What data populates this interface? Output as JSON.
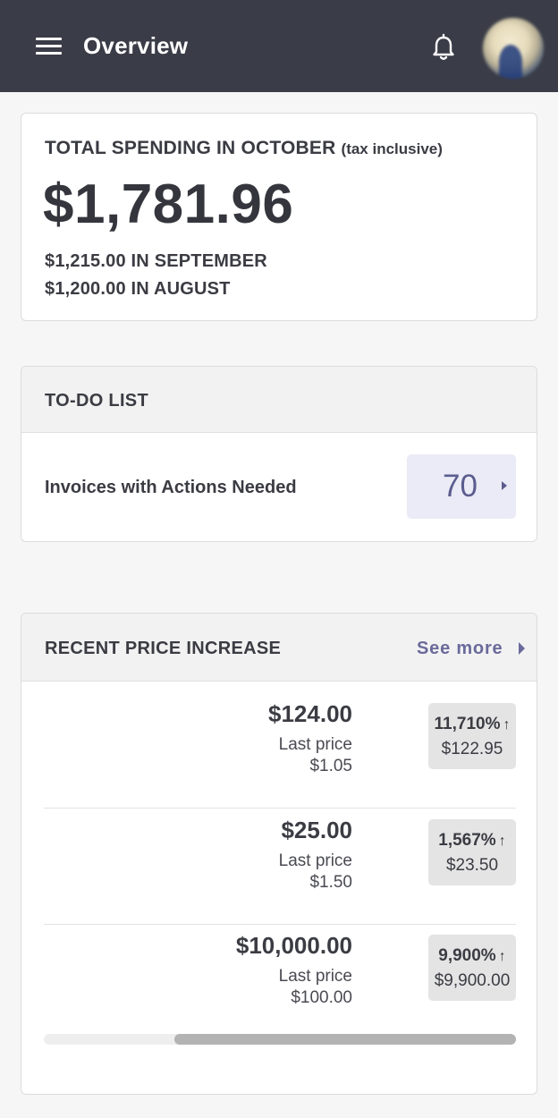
{
  "topbar": {
    "title": "Overview",
    "menu_icon": "hamburger-menu-icon",
    "bell_icon": "bell-icon",
    "avatar": "user-avatar"
  },
  "spending": {
    "heading": "TOTAL SPENDING IN OCTOBER",
    "heading_note": "(tax inclusive)",
    "total": "$1,781.96",
    "previous": [
      "$1,215.00 IN SEPTEMBER",
      "$1,200.00 IN AUGUST"
    ]
  },
  "todo": {
    "title": "TO-DO LIST",
    "item_label": "Invoices with Actions Needed",
    "item_count": "70"
  },
  "price_increase": {
    "title": "RECENT PRICE INCREASE",
    "see_more": "See more",
    "last_price_label": "Last price",
    "rows": [
      {
        "price": "$124.00",
        "last_price": "$1.05",
        "percent": "11,710%",
        "diff": "$122.95"
      },
      {
        "price": "$25.00",
        "last_price": "$1.50",
        "percent": "1,567%",
        "diff": "$23.50"
      },
      {
        "price": "$10,000.00",
        "last_price": "$100.00",
        "percent": "9,900%",
        "diff": "$9,900.00"
      }
    ],
    "arrow_glyph": "↑"
  },
  "colors": {
    "topbar": "#3a3c47",
    "accent": "#6a6a9c",
    "badge_bg": "#ebebf7"
  }
}
